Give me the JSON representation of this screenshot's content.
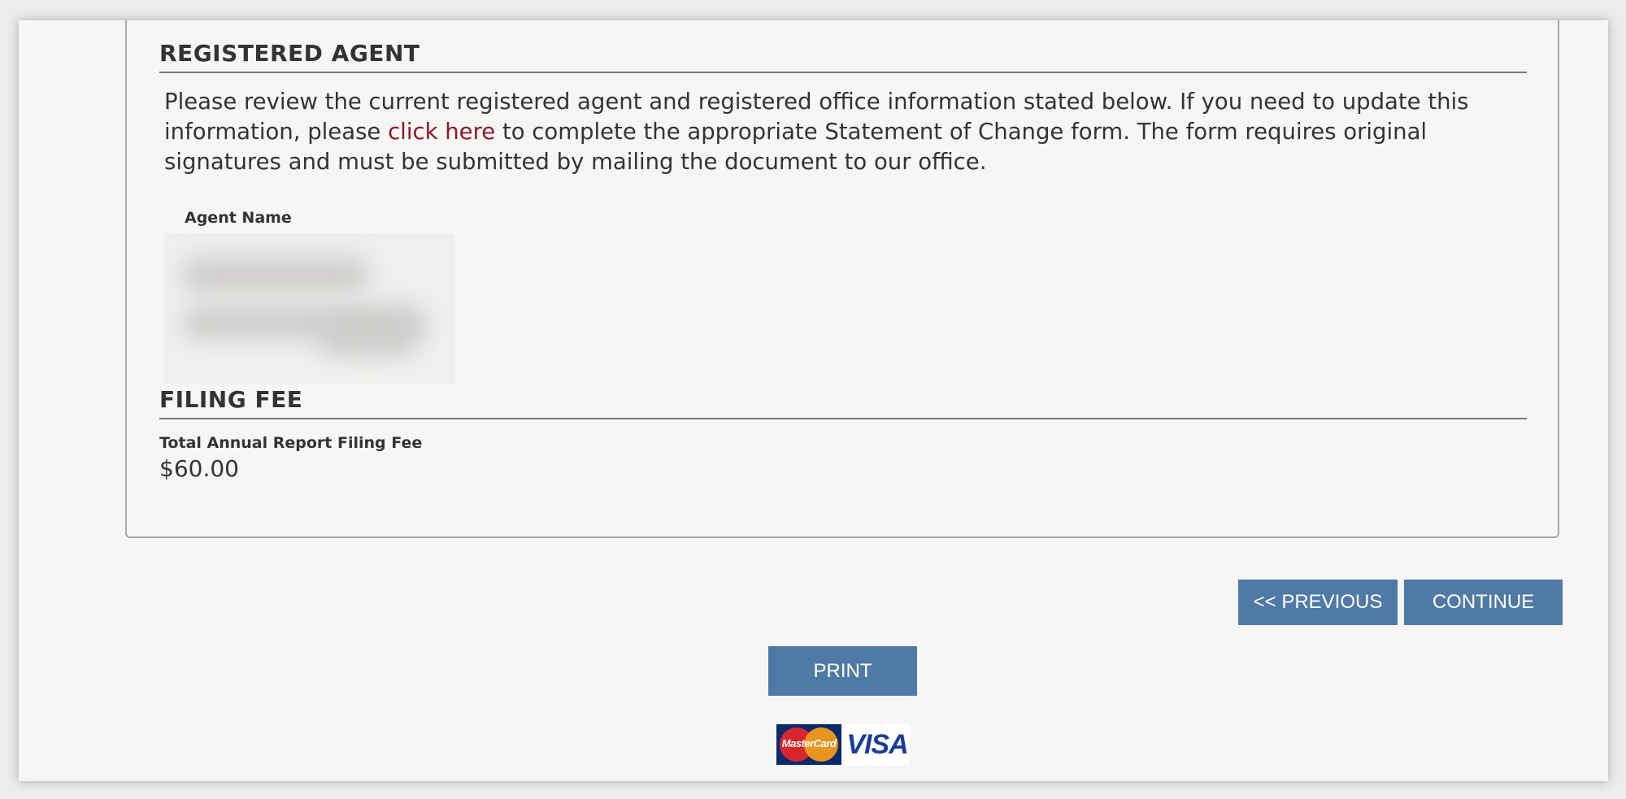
{
  "registered_agent": {
    "heading": "REGISTERED AGENT",
    "intro_before_link": "Please review the current registered agent and registered office information stated below. If you need to update this information, please ",
    "link_text": "click here",
    "intro_after_link": " to complete the appropriate Statement of Change form. The form requires original signatures and must be submitted by mailing the document to our office.",
    "agent_name_label": "Agent Name"
  },
  "filing_fee": {
    "heading": "FILING FEE",
    "total_label": "Total Annual Report Filing Fee",
    "total_value": "$60.00"
  },
  "buttons": {
    "previous": "<< PREVIOUS",
    "continue": "CONTINUE",
    "print": "PRINT"
  },
  "payment": {
    "mastercard_text": "MasterCard",
    "visa_text": "VISA"
  },
  "colors": {
    "button_bg": "#4f7aa5",
    "link": "#8b1a2b",
    "page_bg": "#f7f6f4"
  },
  "icons": [
    "mastercard-logo",
    "visa-logo"
  ]
}
